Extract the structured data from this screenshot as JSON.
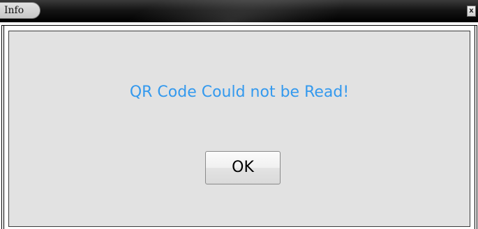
{
  "window": {
    "title": "Info",
    "close_glyph": "x"
  },
  "dialog": {
    "message": "QR Code Could not be Read!",
    "ok_label": "OK",
    "message_color": "#3399ee"
  },
  "icons": {
    "close": "close-icon"
  }
}
